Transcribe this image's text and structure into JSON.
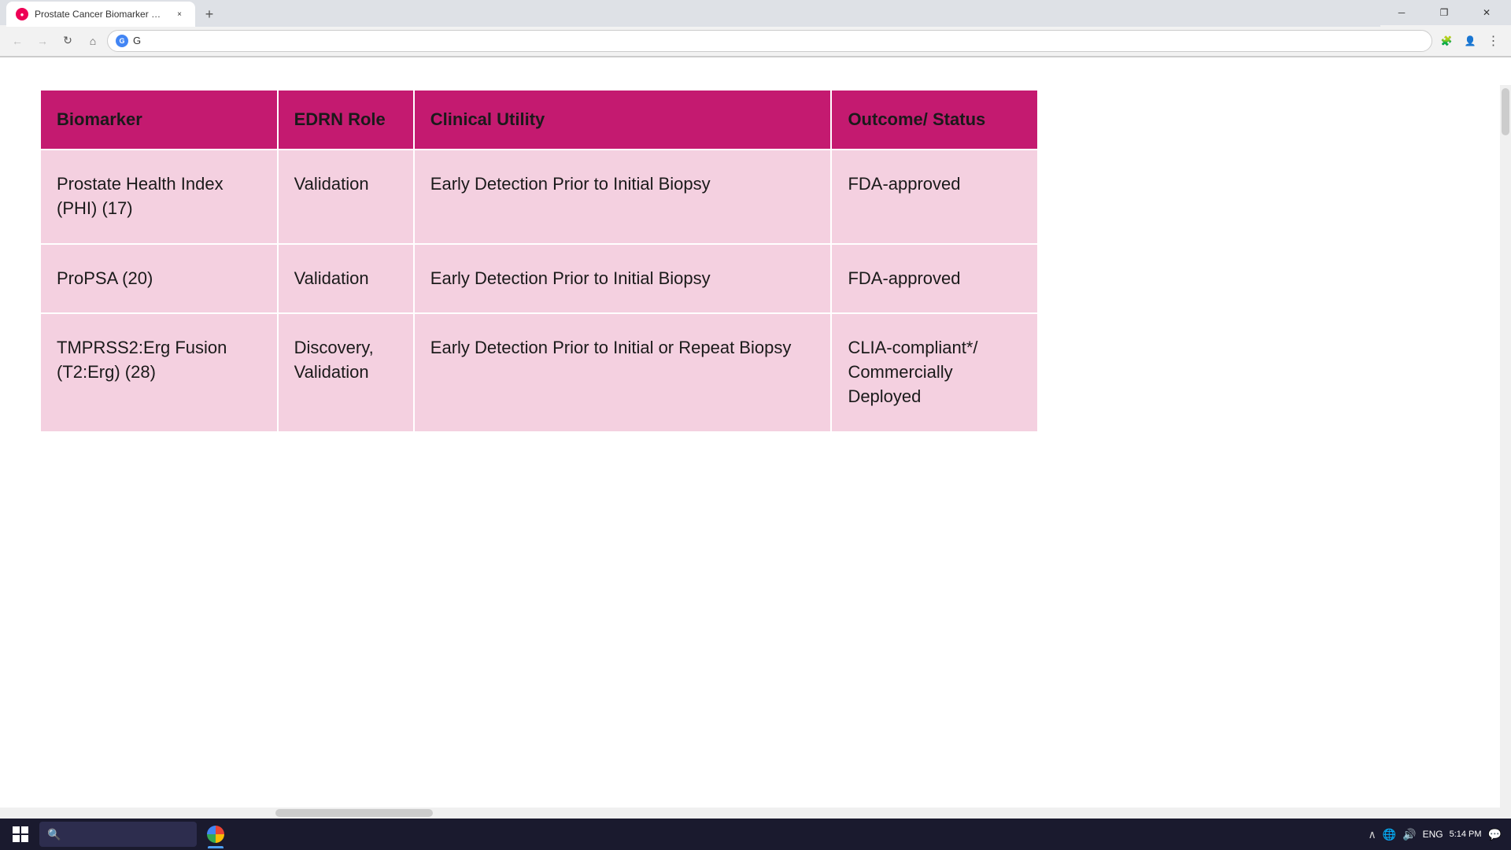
{
  "browser": {
    "tab_title": "Prostate Cancer Biomarker Devel",
    "tab_icon": "●",
    "new_tab_icon": "+",
    "close_tab_icon": "×",
    "nav_back": "←",
    "nav_forward": "→",
    "nav_refresh": "↻",
    "nav_home": "⌂",
    "address_value": "G",
    "window_minimize": "─",
    "window_maximize": "❐",
    "window_close": "✕"
  },
  "table": {
    "headers": {
      "biomarker": "Biomarker",
      "edrn_role": "EDRN Role",
      "clinical_utility": "Clinical Utility",
      "outcome_status": "Outcome/ Status"
    },
    "rows": [
      {
        "biomarker": "Prostate Health Index (PHI) (17)",
        "edrn_role": "Validation",
        "clinical_utility": "Early Detection Prior to Initial Biopsy",
        "outcome_status": "FDA-approved"
      },
      {
        "biomarker": "ProPSA (20)",
        "edrn_role": "Validation",
        "clinical_utility": "Early Detection Prior to Initial Biopsy",
        "outcome_status": "FDA-approved"
      },
      {
        "biomarker": "TMPRSS2:Erg Fusion (T2:Erg) (28)",
        "edrn_role": "Discovery, Validation",
        "clinical_utility": "Early Detection Prior to Initial or Repeat Biopsy",
        "outcome_status": "CLIA-compliant*/ Commercially Deployed"
      }
    ]
  },
  "taskbar": {
    "search_placeholder": "",
    "time": "5:14 PM",
    "date": "",
    "language": "ENG"
  }
}
